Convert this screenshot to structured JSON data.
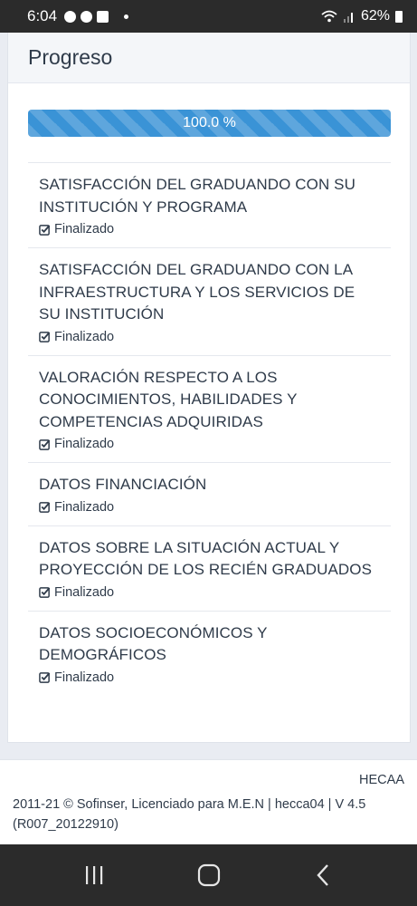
{
  "status_bar": {
    "time": "6:04",
    "battery": "62%"
  },
  "card": {
    "title": "Progreso",
    "progress": {
      "value": 1.0,
      "label": "100.0 %",
      "color": "#3a93d6"
    },
    "items": [
      {
        "title": "SATISFACCIÓN DEL GRADUANDO CON SU INSTITUCIÓN Y PROGRAMA",
        "status": "Finalizado"
      },
      {
        "title": "SATISFACCIÓN DEL GRADUANDO CON LA INFRAESTRUCTURA Y LOS SERVICIOS DE SU INSTITUCIÓN",
        "status": "Finalizado"
      },
      {
        "title": "VALORACIÓN RESPECTO A LOS CONOCIMIENTOS, HABILIDADES Y COMPETENCIAS ADQUIRIDAS",
        "status": "Finalizado"
      },
      {
        "title": "DATOS FINANCIACIÓN",
        "status": "Finalizado"
      },
      {
        "title": "DATOS SOBRE LA SITUACIÓN ACTUAL Y PROYECCIÓN DE LOS RECIÉN GRADUADOS",
        "status": "Finalizado"
      },
      {
        "title": "DATOS SOCIOECONÓMICOS Y DEMOGRÁFICOS",
        "status": "Finalizado"
      }
    ]
  },
  "footer": {
    "brand": "HECAA",
    "text": "2011-21 © Sofinser, Licenciado para M.E.N | hecca04 | V 4.5 (R007_20122910)"
  },
  "icons": {
    "status": [
      "facebook-messenger-icon",
      "facebook-icon",
      "gallery-icon",
      "notification-dot-icon",
      "wifi-icon",
      "signal-icon",
      "battery-icon"
    ],
    "item_status": "check-square-icon",
    "nav": [
      "recent-apps-icon",
      "home-icon",
      "back-icon"
    ]
  }
}
